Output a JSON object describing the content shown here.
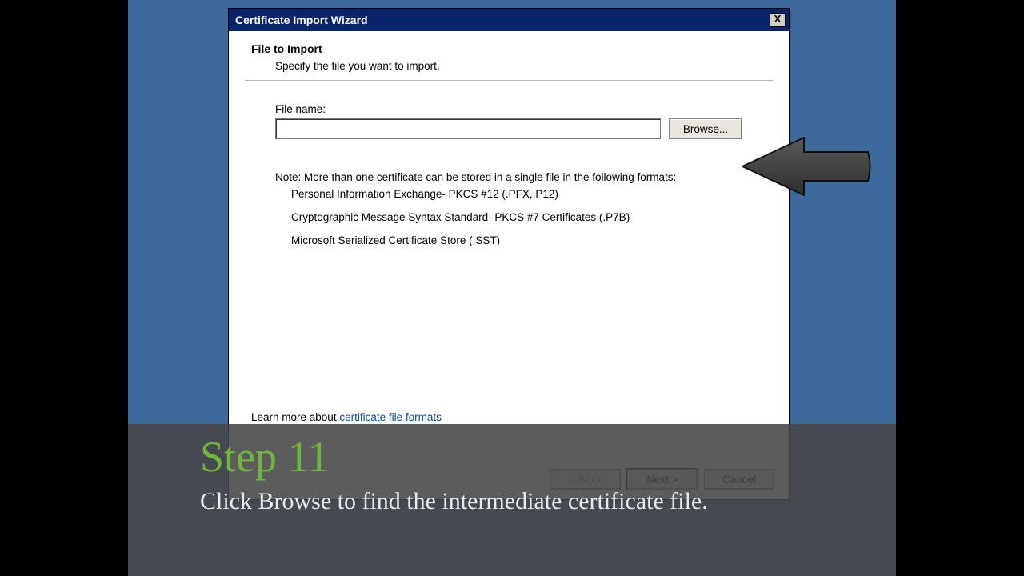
{
  "window": {
    "title": "Certificate Import Wizard",
    "close_icon": "X"
  },
  "page": {
    "heading": "File to Import",
    "subheading": "Specify the file you want to import."
  },
  "file": {
    "label": "File name:",
    "value": "",
    "browse": "Browse..."
  },
  "note": {
    "intro": "Note:  More than one certificate can be stored in a single file in the following formats:",
    "items": [
      "Personal Information Exchange- PKCS #12 (.PFX,.P12)",
      "Cryptographic Message Syntax Standard- PKCS #7 Certificates (.P7B)",
      "Microsoft Serialized Certificate Store (.SST)"
    ]
  },
  "learn": {
    "prefix": "Learn more about ",
    "link": "certificate file formats"
  },
  "footer": {
    "back": "< Back",
    "next": "Next >",
    "cancel": "Cancel"
  },
  "caption": {
    "title": "Step 11",
    "text": "Click Browse to find the intermediate certificate file."
  }
}
